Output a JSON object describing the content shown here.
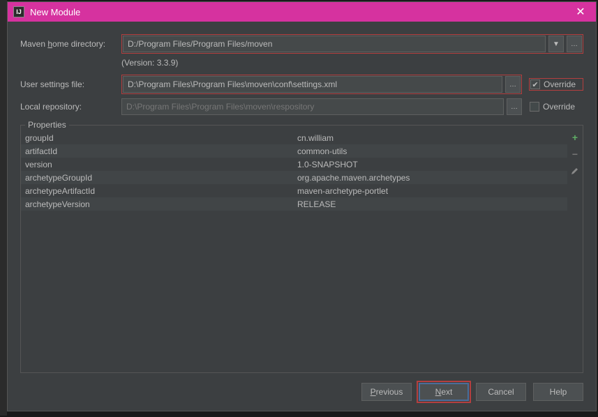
{
  "window": {
    "title": "New Module",
    "icon_label": "IJ"
  },
  "fields": {
    "maven_home": {
      "label_prefix": "Maven ",
      "label_hotkey": "h",
      "label_suffix": "ome directory:",
      "value": "D:/Program Files/Program Files/moven"
    },
    "version_text": "(Version: 3.3.9)",
    "user_settings": {
      "label": "User settings file:",
      "value": "D:\\Program Files\\Program Files\\moven\\conf\\settings.xml",
      "override_label": "Override",
      "override_checked": true
    },
    "local_repo": {
      "label": "Local repository:",
      "value": "D:\\Program Files\\Program Files\\moven\\respository",
      "override_label": "Override",
      "override_checked": false
    }
  },
  "properties": {
    "title": "Properties",
    "rows": [
      {
        "key": "groupId",
        "value": "cn.william"
      },
      {
        "key": "artifactId",
        "value": "common-utils"
      },
      {
        "key": "version",
        "value": "1.0-SNAPSHOT"
      },
      {
        "key": "archetypeGroupId",
        "value": "org.apache.maven.archetypes"
      },
      {
        "key": "archetypeArtifactId",
        "value": "maven-archetype-portlet"
      },
      {
        "key": "archetypeVersion",
        "value": "RELEASE"
      }
    ]
  },
  "buttons": {
    "previous_hotkey": "P",
    "previous_suffix": "revious",
    "next_hotkey": "N",
    "next_suffix": "ext",
    "cancel": "Cancel",
    "help": "Help"
  }
}
